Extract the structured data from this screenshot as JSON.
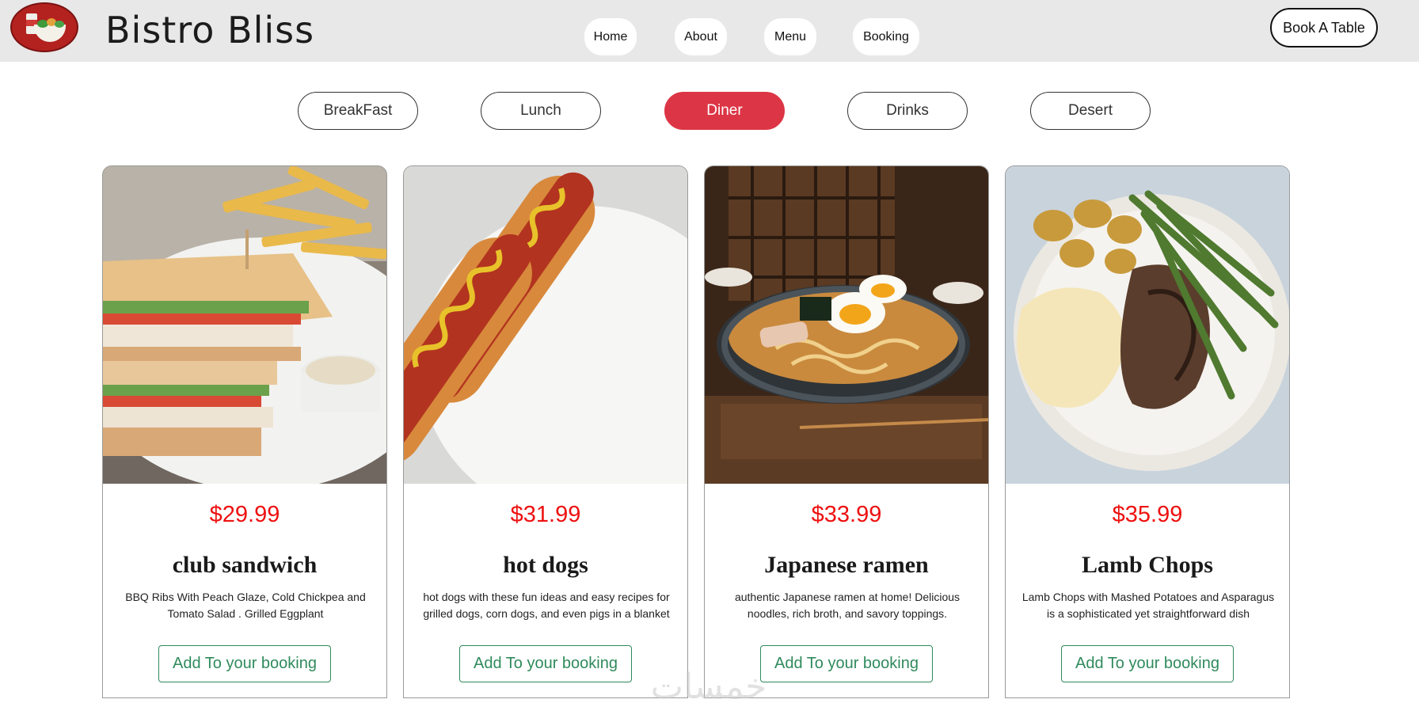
{
  "header": {
    "brand": "Bistro Bliss",
    "logo_icon": "salad-bowl-logo-icon",
    "nav": [
      {
        "label": "Home"
      },
      {
        "label": "About"
      },
      {
        "label": "Menu"
      },
      {
        "label": "Booking"
      }
    ],
    "cta_label": "Book A Table"
  },
  "categories": {
    "active": "Diner",
    "items": [
      {
        "label": "BreakFast"
      },
      {
        "label": "Lunch"
      },
      {
        "label": "Diner"
      },
      {
        "label": "Drinks"
      },
      {
        "label": "Desert"
      }
    ]
  },
  "menu_items": [
    {
      "price": "$29.99",
      "name": "club sandwich",
      "description": "BBQ Ribs With Peach Glaze, Cold Chickpea and Tomato Salad . Grilled Eggplant",
      "button": "Add To your booking"
    },
    {
      "price": "$31.99",
      "name": "hot dogs",
      "description": "hot dogs with these fun ideas and easy recipes for grilled dogs, corn dogs, and even pigs in a blanket",
      "button": "Add To your booking"
    },
    {
      "price": "$33.99",
      "name": "Japanese ramen",
      "description": "authentic Japanese ramen at home! Delicious noodles, rich broth, and savory toppings.",
      "button": "Add To your booking"
    },
    {
      "price": "$35.99",
      "name": "Lamb Chops",
      "description": "Lamb Chops with Mashed Potatoes and Asparagus is a sophisticated yet straightforward dish",
      "button": "Add To your booking"
    }
  ],
  "watermark": "خمسات",
  "colors": {
    "accent": "#dc3545",
    "price": "#ee1111",
    "button": "#2f8a5c",
    "header_bg": "#e8e8e8"
  }
}
